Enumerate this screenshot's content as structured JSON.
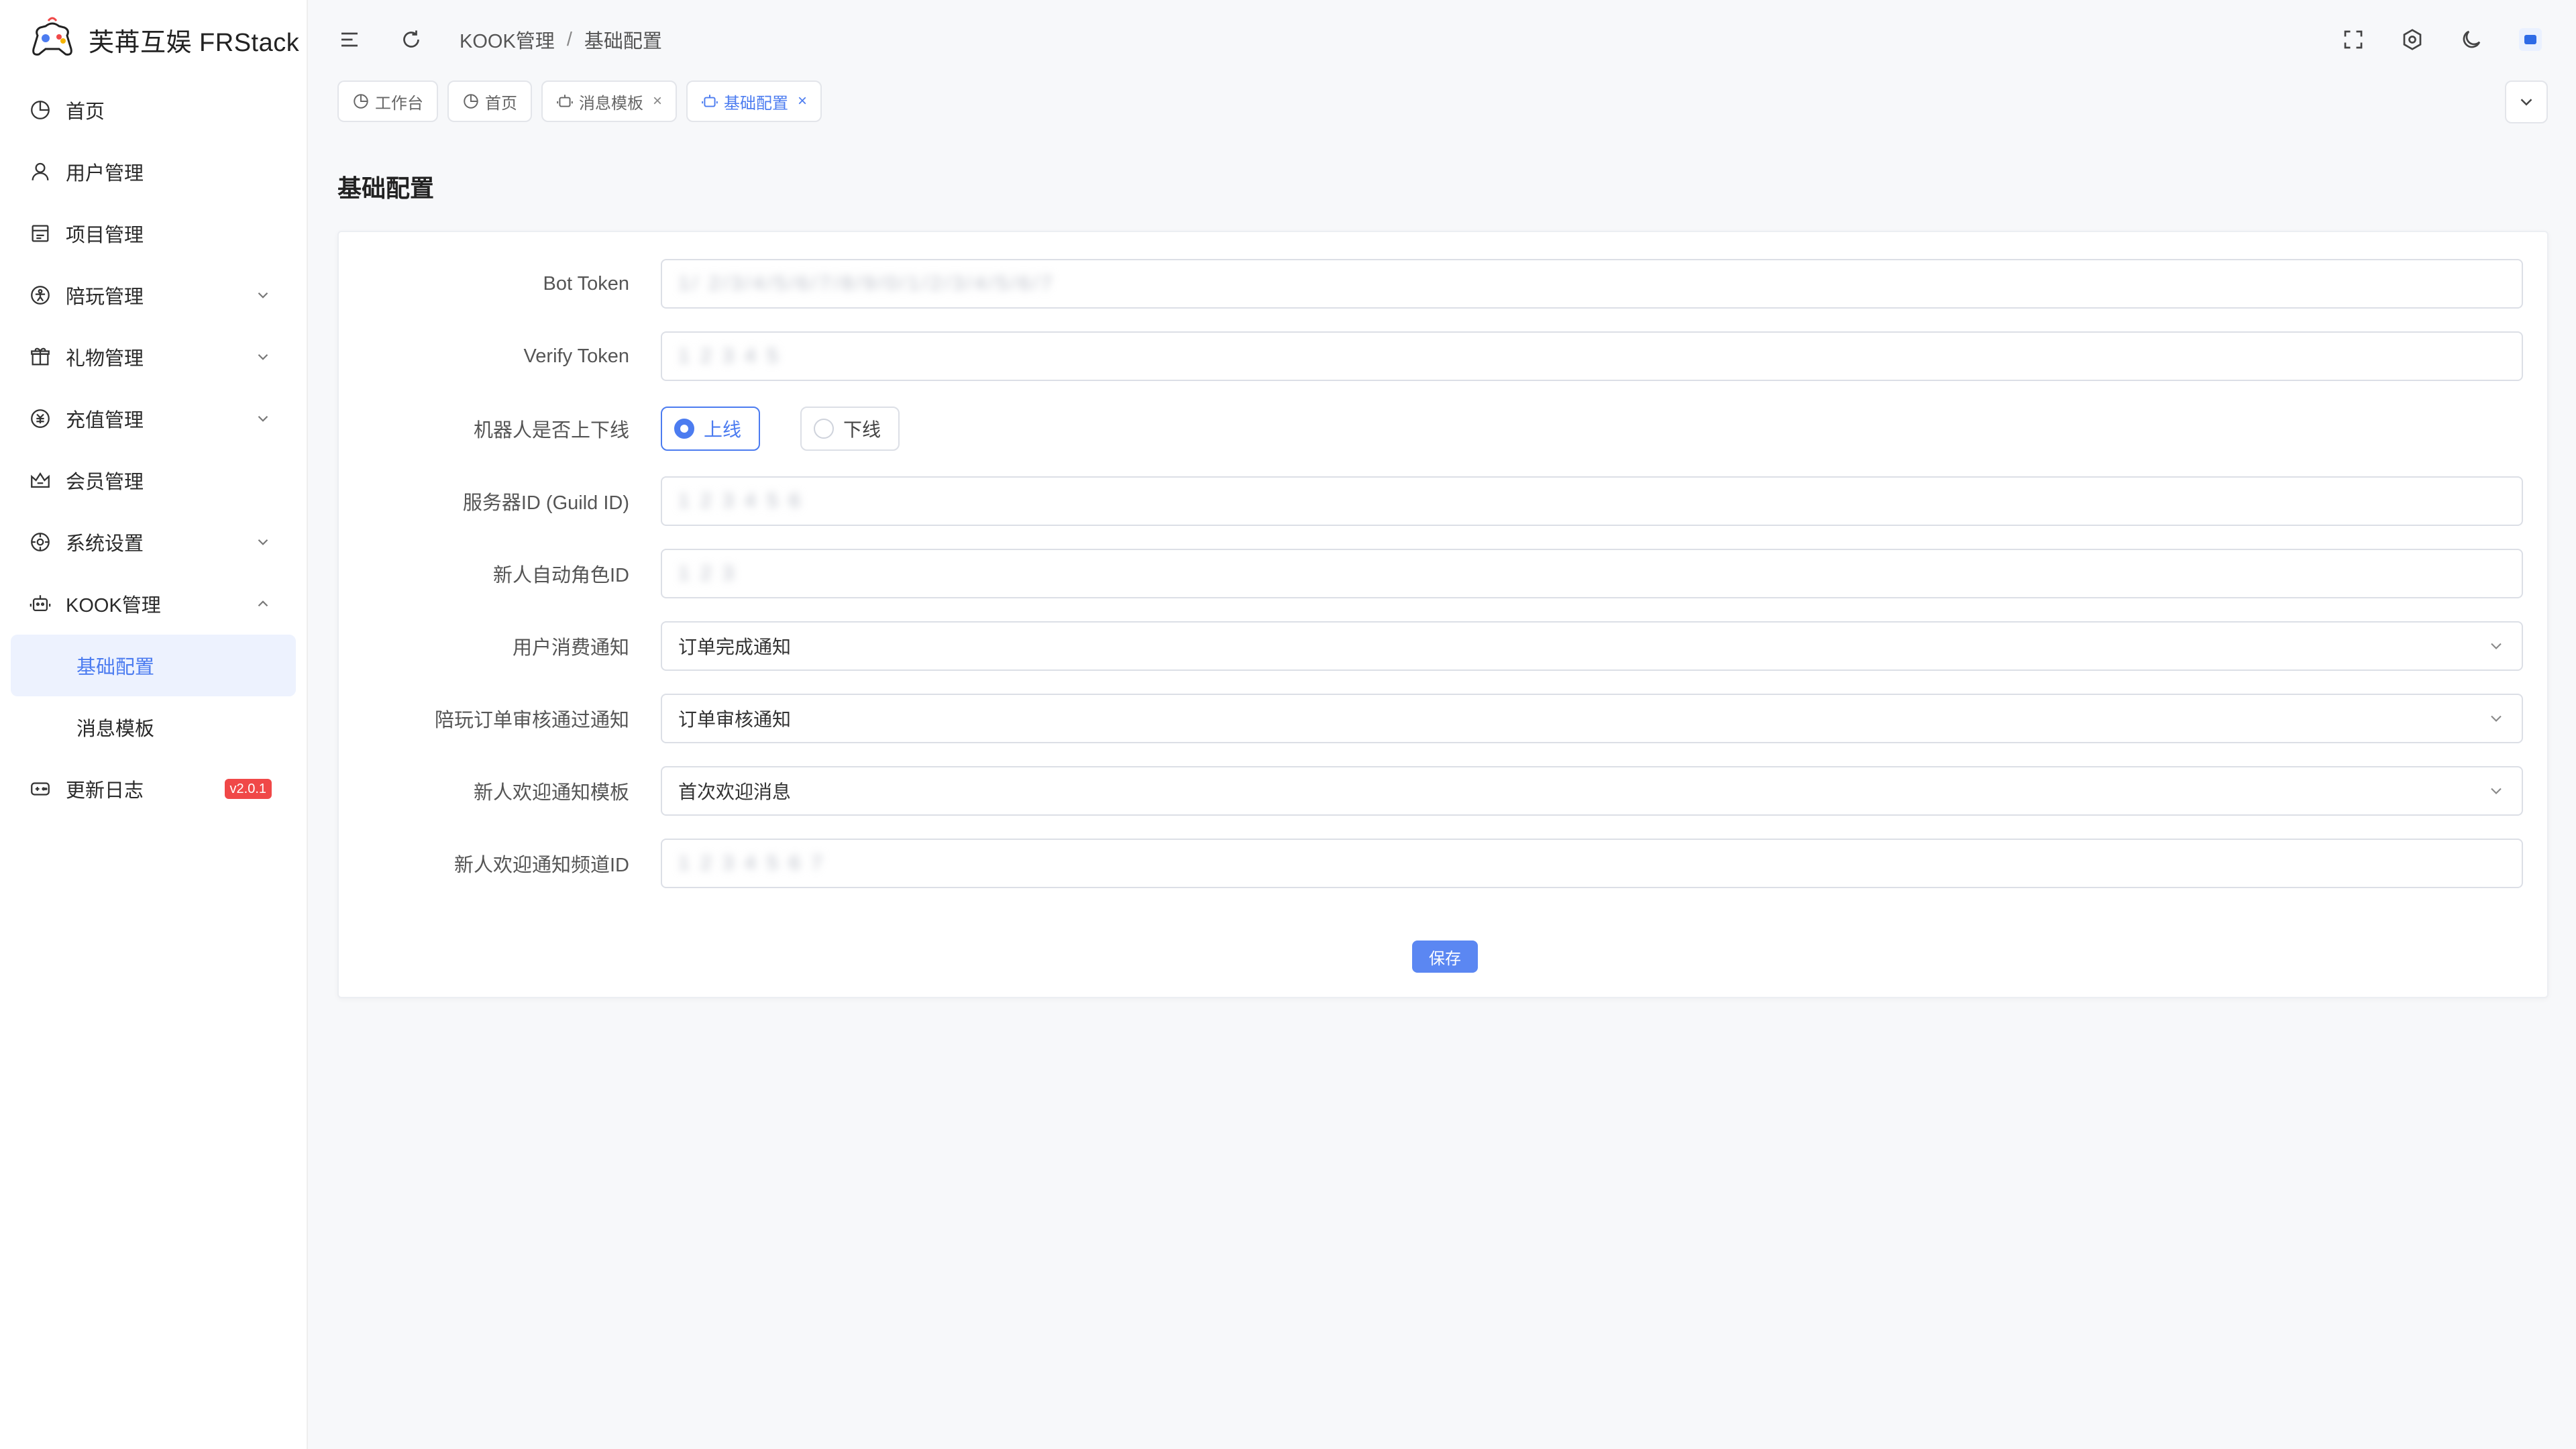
{
  "app": {
    "title": "芙苒互娱 FRStack"
  },
  "sidebar": {
    "items": [
      {
        "label": "首页",
        "icon": "dashboard-icon"
      },
      {
        "label": "用户管理",
        "icon": "user-icon"
      },
      {
        "label": "项目管理",
        "icon": "project-icon"
      },
      {
        "label": "陪玩管理",
        "icon": "companion-icon",
        "expandable": true
      },
      {
        "label": "礼物管理",
        "icon": "gift-icon",
        "expandable": true
      },
      {
        "label": "充值管理",
        "icon": "recharge-icon",
        "expandable": true
      },
      {
        "label": "会员管理",
        "icon": "crown-icon"
      },
      {
        "label": "系统设置",
        "icon": "settings-icon",
        "expandable": true
      },
      {
        "label": "KOOK管理",
        "icon": "robot-icon",
        "expanded": true
      },
      {
        "label": "更新日志",
        "icon": "log-icon",
        "badge": "v2.0.1"
      }
    ],
    "kook_sub": [
      {
        "label": "基础配置",
        "active": true
      },
      {
        "label": "消息模板",
        "active": false
      }
    ]
  },
  "header": {
    "breadcrumb": [
      "KOOK管理",
      "基础配置"
    ],
    "breadcrumb_sep": "/"
  },
  "tabs": [
    {
      "label": "工作台",
      "icon": "dashboard-icon",
      "closable": false
    },
    {
      "label": "首页",
      "icon": "dashboard-icon",
      "closable": false
    },
    {
      "label": "消息模板",
      "icon": "robot-icon",
      "closable": true
    },
    {
      "label": "基础配置",
      "icon": "robot-icon",
      "closable": true,
      "active": true
    }
  ],
  "tab_close_glyph": "×",
  "page": {
    "title": "基础配置"
  },
  "form": {
    "bot_token": {
      "label": "Bot Token",
      "value": "1/ 2/3/4/5/6/7/8/9/0/1/2/3/4/5/6/7"
    },
    "verify_token": {
      "label": "Verify Token",
      "value": "1 2 3 4 5"
    },
    "bot_online": {
      "label": "机器人是否上下线",
      "options": [
        "上线",
        "下线"
      ],
      "selected": "上线"
    },
    "guild_id": {
      "label": "服务器ID (Guild ID)",
      "value": "1 2 3 4 5 6"
    },
    "auto_role_id": {
      "label": "新人自动角色ID",
      "value": "1 2 3"
    },
    "consume_notify": {
      "label": "用户消费通知",
      "value": "订单完成通知"
    },
    "order_review_notify": {
      "label": "陪玩订单审核通过通知",
      "value": "订单审核通知"
    },
    "welcome_template": {
      "label": "新人欢迎通知模板",
      "value": "首次欢迎消息"
    },
    "welcome_channel_id": {
      "label": "新人欢迎通知频道ID",
      "value": "1 2 3 4 5 6 7"
    },
    "save_label": "保存"
  },
  "colors": {
    "primary": "#4c7cf0",
    "active_bg": "#edf2fe",
    "badge": "#f04848",
    "page_bg": "#f7f8fa"
  }
}
